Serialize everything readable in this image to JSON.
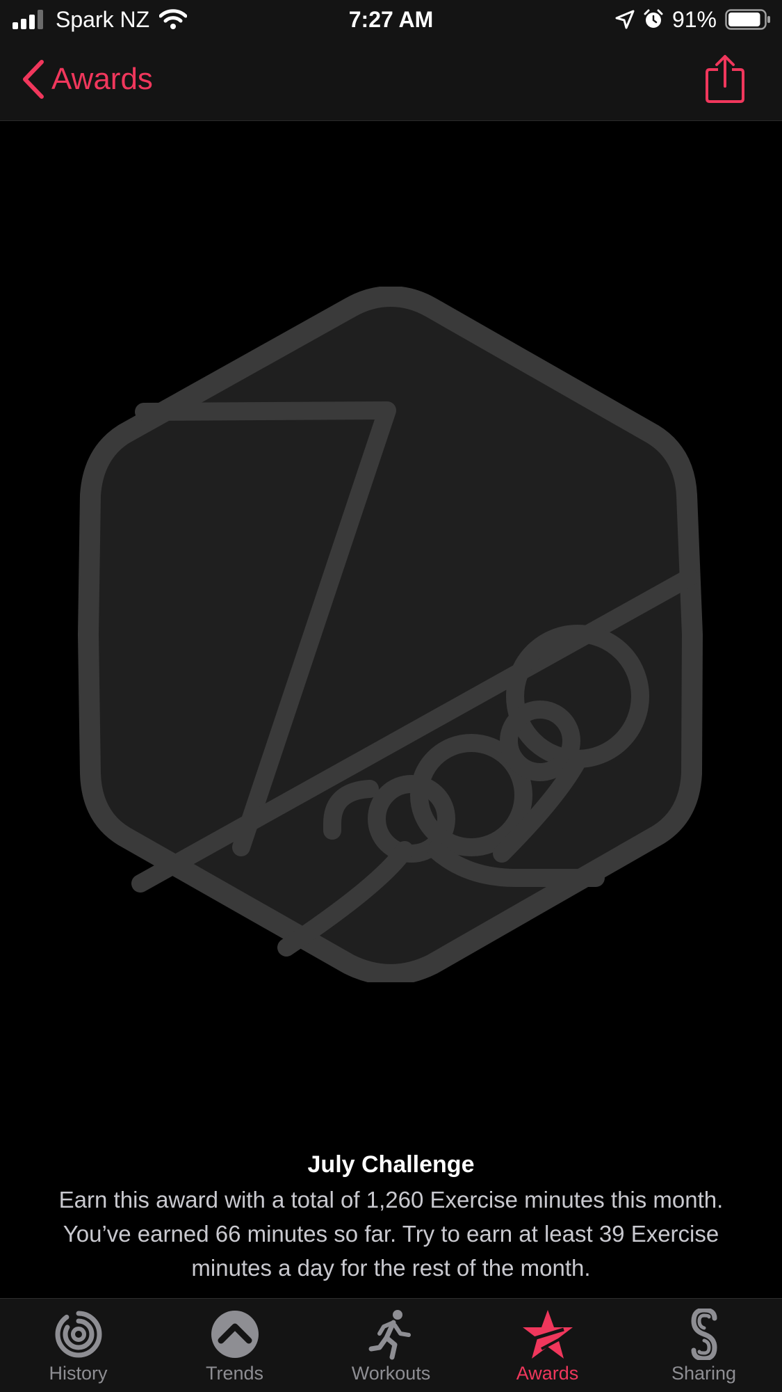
{
  "status_bar": {
    "carrier": "Spark NZ",
    "time": "7:27 AM",
    "battery_percent": "91%",
    "icons": [
      "signal-bars-icon",
      "wifi-icon",
      "location-arrow-icon",
      "alarm-clock-icon",
      "battery-icon"
    ],
    "battery_level": 0.91
  },
  "nav": {
    "back_label": "Awards",
    "back_icon": "chevron-left-icon",
    "share_icon": "share-icon"
  },
  "badge": {
    "icon": "july-challenge-badge-icon"
  },
  "award": {
    "title": "July Challenge",
    "description": "Earn this award with a total of 1,260 Exercise minutes this month. You’ve earned 66 minutes so far. Try to earn at least 39 Exercise minutes a day for the rest of the month."
  },
  "tabs": [
    {
      "label": "History",
      "icon": "history-rings-icon",
      "active": false
    },
    {
      "label": "Trends",
      "icon": "trends-chevron-up-icon",
      "active": false
    },
    {
      "label": "Workouts",
      "icon": "running-figure-icon",
      "active": false
    },
    {
      "label": "Awards",
      "icon": "award-star-icon",
      "active": true
    },
    {
      "label": "Sharing",
      "icon": "sharing-icon",
      "active": false
    }
  ],
  "colors": {
    "accent": "#f0375c",
    "background": "#000000",
    "bar_background": "#141414",
    "badge_fill": "#1f1f1f",
    "badge_stroke": "#3a3a3a",
    "inactive_tab": "#8e8e93"
  }
}
